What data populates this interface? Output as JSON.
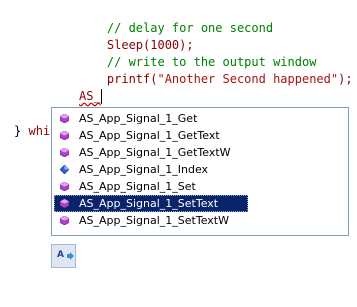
{
  "code": {
    "lines": [
      {
        "comment": "// delay for one second"
      },
      {
        "prefix": "Sleep(1000);"
      },
      {
        "comment": "// write to the output window"
      },
      {
        "prefix": "printf(",
        "string": "\"Another Second happened\"",
        "suffix": ");"
      }
    ],
    "typed_text": "AS_",
    "closing_brace": "}",
    "partial_keyword": "whi"
  },
  "autocomplete": {
    "items": [
      {
        "label": "AS_App_Signal_1_Get",
        "icon": "method-icon"
      },
      {
        "label": "AS_App_Signal_1_GetText",
        "icon": "method-icon"
      },
      {
        "label": "AS_App_Signal_1_GetTextW",
        "icon": "method-icon"
      },
      {
        "label": "AS_App_Signal_1_Index",
        "icon": "field-icon"
      },
      {
        "label": "AS_App_Signal_1_Set",
        "icon": "method-icon"
      },
      {
        "label": "AS_App_Signal_1_SetText",
        "icon": "method-icon"
      },
      {
        "label": "AS_App_Signal_1_SetTextW",
        "icon": "method-icon"
      }
    ],
    "selected_index": 5,
    "filter_icon_label": "A"
  },
  "colors": {
    "selection": "#0a246a",
    "comment": "#008000",
    "code": "#8b0000",
    "method_icon": "#b040c8",
    "field_icon": "#3060d0"
  }
}
